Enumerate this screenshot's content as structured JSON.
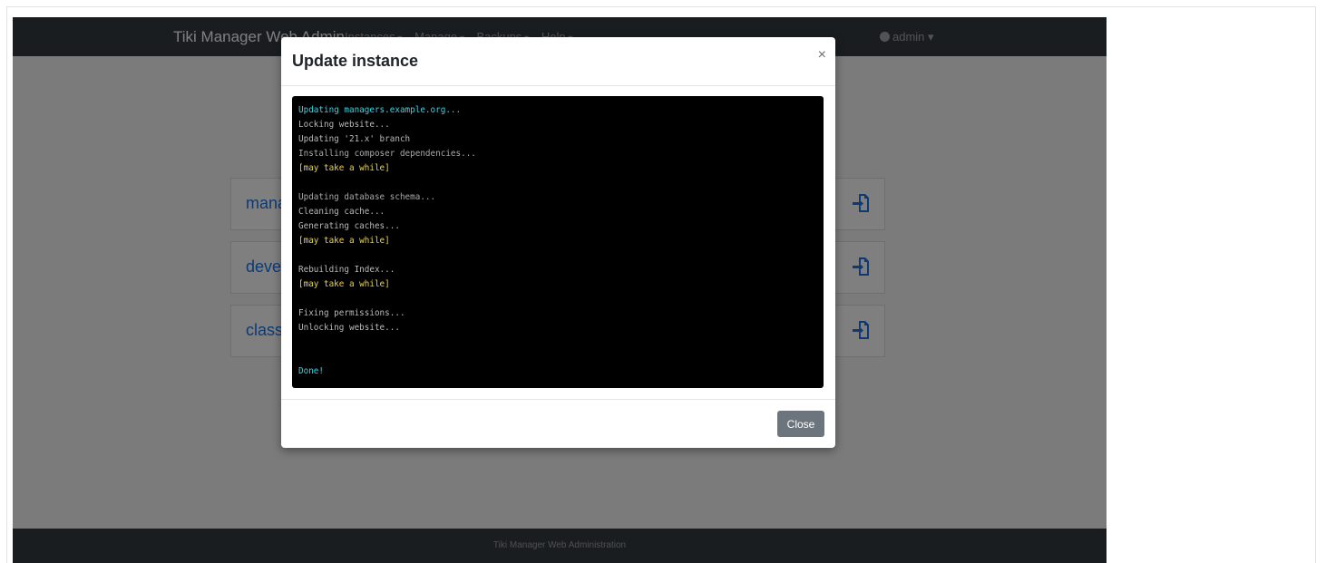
{
  "navbar": {
    "brand": "Tiki Manager Web Admin",
    "menus": [
      "Instances",
      "Manage",
      "Backups",
      "Help"
    ],
    "user": "admin"
  },
  "instances": [
    {
      "name": "mana"
    },
    {
      "name": "deve"
    },
    {
      "name": "class"
    }
  ],
  "footer": {
    "text": "Tiki Manager Web Administration"
  },
  "modal": {
    "title": "Update instance",
    "close_symbol": "×",
    "close_button": "Close",
    "log_lines": [
      {
        "text": "Updating managers.example.org...",
        "style": "cyan"
      },
      {
        "text": "Locking website...",
        "style": "normal"
      },
      {
        "text": "Updating '21.x' branch",
        "style": "normal"
      },
      {
        "text": "Installing composer dependencies...",
        "style": "dim"
      },
      {
        "text": "[may take a while]",
        "style": "yellow"
      },
      {
        "text": "",
        "style": "normal"
      },
      {
        "text": "Updating database schema...",
        "style": "dim"
      },
      {
        "text": "Cleaning cache...",
        "style": "normal"
      },
      {
        "text": "Generating caches...",
        "style": "normal"
      },
      {
        "text": "[may take a while]",
        "style": "yellow"
      },
      {
        "text": "",
        "style": "normal"
      },
      {
        "text": "Rebuilding Index...",
        "style": "normal"
      },
      {
        "text": "[may take a while]",
        "style": "yellow"
      },
      {
        "text": "",
        "style": "normal"
      },
      {
        "text": "Fixing permissions...",
        "style": "normal"
      },
      {
        "text": "Unlocking website...",
        "style": "normal"
      },
      {
        "text": "",
        "style": "normal"
      },
      {
        "text": "",
        "style": "normal"
      },
      {
        "text": "Done!",
        "style": "cyan"
      }
    ]
  },
  "colors": {
    "navbar_bg": "#343a40",
    "link": "#1a73e8",
    "login_icon": "#1a73e8",
    "terminal_cyan": "#35d7e8",
    "terminal_yellow": "#ecd44a",
    "close_button_bg": "#6c757d"
  }
}
